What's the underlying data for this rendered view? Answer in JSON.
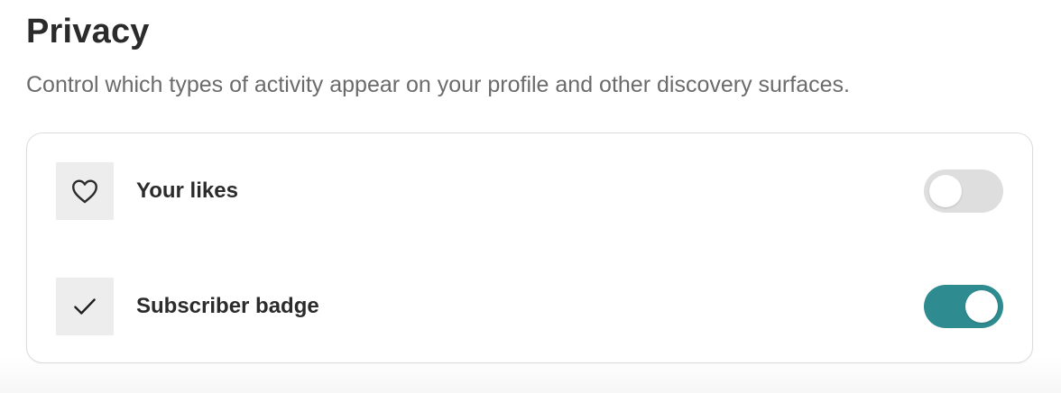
{
  "privacy": {
    "title": "Privacy",
    "description": "Control which types of activity appear on your profile and other discovery surfaces."
  },
  "settings": [
    {
      "label": "Your likes",
      "icon": "heart-icon",
      "enabled": false
    },
    {
      "label": "Subscriber badge",
      "icon": "checkmark-icon",
      "enabled": true
    }
  ],
  "colors": {
    "toggle_on": "#2e8b8f",
    "toggle_off": "#dedede",
    "icon_bg": "#ededed"
  }
}
